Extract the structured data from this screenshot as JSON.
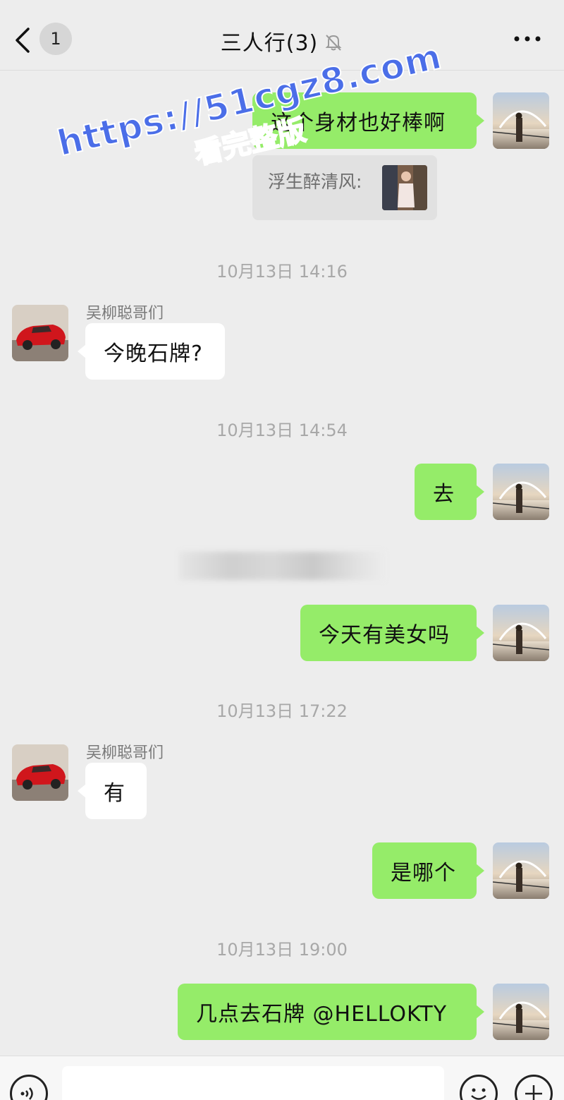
{
  "header": {
    "unread_count": "1",
    "title": "三人行(3)"
  },
  "watermark": {
    "url": "https://51cgz8.com",
    "tagline": "看完整版"
  },
  "messages": [
    {
      "text": "这个身材也好棒啊"
    },
    {
      "quote_sender": "浮生醉清风:"
    },
    {
      "time": "10月13日 14:16"
    },
    {
      "sender": "吴柳聪哥们",
      "text": "今晚石牌?"
    },
    {
      "time": "10月13日 14:54"
    },
    {
      "text": "去"
    },
    {
      "text": "今天有美女吗"
    },
    {
      "time": "10月13日 17:22"
    },
    {
      "sender": "吴柳聪哥们",
      "text": "有"
    },
    {
      "text": "是哪个"
    },
    {
      "time": "10月13日 19:00"
    },
    {
      "text": "几点去石牌 @HELLOKTY"
    }
  ],
  "colors": {
    "outgoing_bubble": "#95ec69",
    "incoming_bubble": "#ffffff",
    "background": "#ededed",
    "watermark": "#4b6ee8"
  },
  "icons": {
    "back": "chevron-left-icon",
    "mute": "bell-off-icon",
    "more": "more-dots-icon",
    "voice": "voice-icon",
    "emoji": "emoji-icon",
    "plus": "plus-icon"
  }
}
